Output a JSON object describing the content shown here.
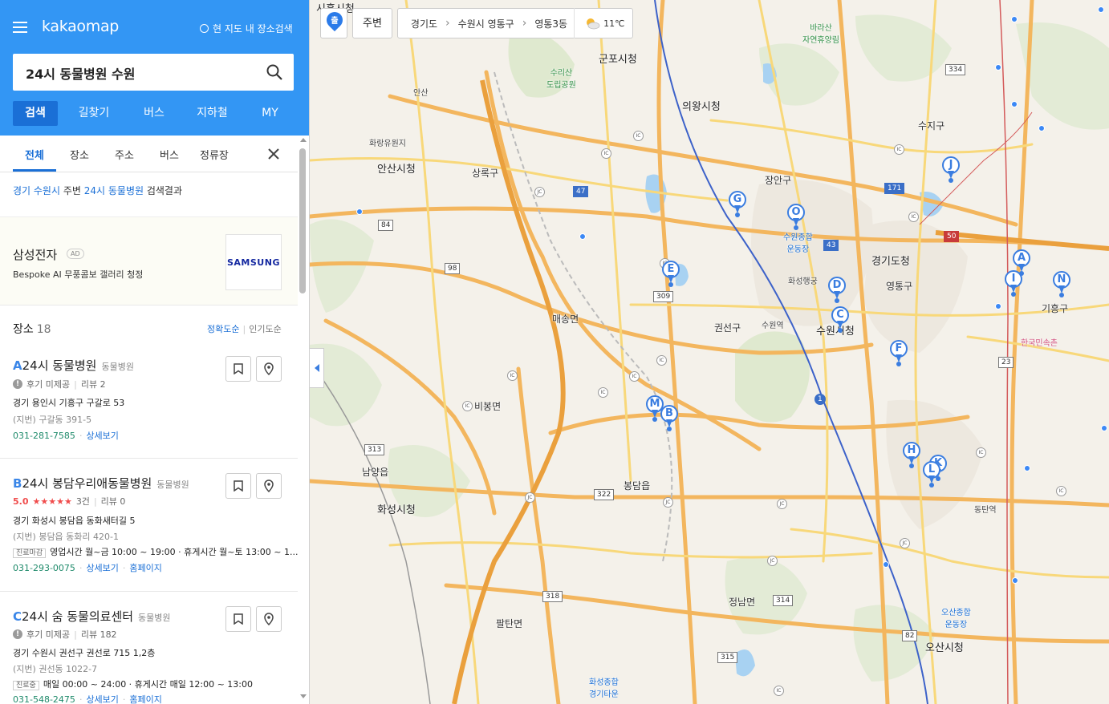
{
  "app": {
    "logo": "kakaomap",
    "area_search": "현 지도 내 장소검색"
  },
  "search": {
    "query": "24시 동물병원 수원"
  },
  "main_tabs": [
    "검색",
    "길찾기",
    "버스",
    "지하철",
    "MY"
  ],
  "sub_tabs": [
    "전체",
    "장소",
    "주소",
    "버스",
    "정류장"
  ],
  "result_info": {
    "region": "경기 수원시",
    "near": " 주변 ",
    "keyword": "24시 동물병원",
    "suffix": " 검색결과"
  },
  "ad": {
    "title": "삼성전자",
    "badge": "AD",
    "desc": "Bespoke AI 무풍콤보 갤러리 청정",
    "logo_text": "SAMSUNG"
  },
  "places": {
    "label": "장소",
    "count": "18",
    "sort_accuracy": "정확도순",
    "sort_popular": "인기도순"
  },
  "results": [
    {
      "letter": "A",
      "name": "24시 동물병원",
      "category": "동물병원",
      "review_status": "후기 미제공",
      "review_count": "리뷰 2",
      "address": "경기 용인시 기흥구 구갈로 53",
      "jibun": "(지번) 구갈동 391-5",
      "phone": "031-281-7585",
      "detail": "상세보기"
    },
    {
      "letter": "B",
      "name": "24시 봉담우리애동물병원",
      "category": "동물병원",
      "score": "5.0",
      "stars": "★★★★★",
      "score_count": "3건",
      "review_count": "리뷰 0",
      "address": "경기 화성시 봉담읍 동화새터길 5",
      "jibun": "(지번) 봉담읍 동화리 420-1",
      "hours_badge": "진료마감",
      "hours": "영업시간 월~금 10:00 ~ 19:00 · 휴게시간 월~토 13:00 ~ 1...",
      "phone": "031-293-0075",
      "detail": "상세보기",
      "homepage": "홈페이지"
    },
    {
      "letter": "C",
      "name": "24시 숨 동물의료센터",
      "category": "동물병원",
      "review_status": "후기 미제공",
      "review_count": "리뷰 182",
      "address": "경기 수원시 권선구 권선로 715 1,2층",
      "jibun": "(지번) 권선동 1022-7",
      "hours_badge": "진료중",
      "hours": "매일 00:00 ~ 24:00 · 휴게시간 매일 12:00 ~ 13:00",
      "phone": "031-548-2475",
      "detail": "상세보기",
      "homepage": "홈페이지"
    }
  ],
  "map": {
    "pin_label": "출",
    "near_button": "주변",
    "breadcrumb": [
      "경기도",
      "수원시 영통구",
      "영통3동"
    ],
    "temperature": "11℃",
    "markers": [
      "A",
      "B",
      "C",
      "D",
      "E",
      "F",
      "G",
      "H",
      "I",
      "J",
      "K",
      "L",
      "M",
      "N",
      "O"
    ],
    "labels": {
      "siheung": "시흥시청",
      "gunpo": "군포시청",
      "uiwang": "의왕시청",
      "ansan": "안산시청",
      "ansan2": "안산",
      "sangnok": "상록구",
      "suji": "수지구",
      "jangan": "장안구",
      "gyeonggi": "경기도청",
      "yeongtong": "영통구",
      "suwon": "수원시청",
      "gwonseon": "권선구",
      "suwon_stn": "수원역",
      "maesong": "매송면",
      "bibong": "비봉면",
      "namyang": "남양읍",
      "hwaseong": "화성시청",
      "bongdam": "봉담읍",
      "jeongnam": "정남면",
      "paltan": "팔탄면",
      "osan": "오산시청",
      "giheung": "기흥구",
      "hwarang": "화랑유원지",
      "baraesan": "바라산\n자연휴양림",
      "suriasan": "수리산\n도립공원",
      "folk": "한국민속촌",
      "stadium": "수원종합\n운동장",
      "osan_stadium": "오산종합\n운동장",
      "hwaseong_stadium": "화성종합\n경기타운",
      "haenggung": "화성행궁",
      "dongtan_stn": "동탄역"
    },
    "routes": [
      "47",
      "84",
      "98",
      "309",
      "313",
      "318",
      "322",
      "314",
      "315",
      "82",
      "23",
      "43",
      "1",
      "171",
      "50",
      "334"
    ]
  },
  "colors": {
    "brand_blue": "#3396f4",
    "tab_active": "#1a6fd6",
    "marker": "#3a7de0",
    "phone": "#1e8a6a"
  }
}
